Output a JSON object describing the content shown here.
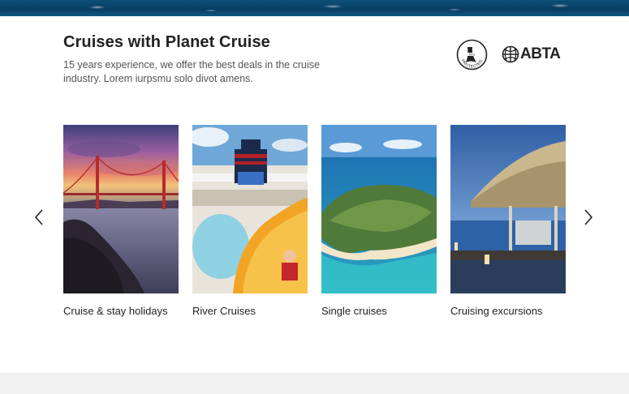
{
  "header": {
    "title": "Cruises with Planet Cruise",
    "subtitle": "15 years experience, we offer the best deals in the cruise industry. Lorem iurpsmu solo divot amens."
  },
  "badges": {
    "atol": {
      "icon": "atol-protected-icon",
      "text": "PROTECTED"
    },
    "abta": {
      "icon": "abta-globe-icon",
      "text": "ABTA"
    }
  },
  "carousel": {
    "prev_icon": "chevron-left-icon",
    "next_icon": "chevron-right-icon",
    "cards": [
      {
        "label": "Cruise & stay holidays",
        "image": "golden-gate-sunset"
      },
      {
        "label": "River Cruises",
        "image": "ship-water-slide"
      },
      {
        "label": "Single cruises",
        "image": "tropical-island-aerial"
      },
      {
        "label": "Cruising excursions",
        "image": "overwater-hut"
      }
    ]
  },
  "colors": {
    "ocean": "#0b4f78",
    "text": "#222222",
    "muted": "#555555"
  }
}
